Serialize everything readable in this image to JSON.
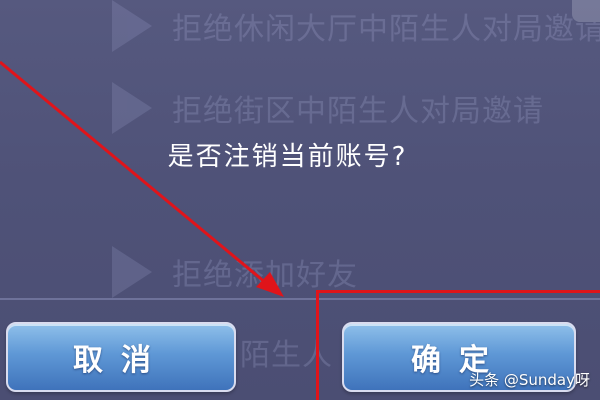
{
  "background": {
    "rows": [
      {
        "text": "拒绝休闲大厅中陌生人对局邀请"
      },
      {
        "text": "拒绝街区中陌生人对局邀请"
      },
      {
        "text": "拒绝添加好友"
      },
      {
        "text": "陌生人"
      }
    ]
  },
  "dialog": {
    "message": "是否注销当前账号?",
    "cancel_label": "取消",
    "confirm_label": "确定"
  },
  "annotation": {
    "color": "#e0141a"
  },
  "watermark": "头条 @Sunday呀"
}
